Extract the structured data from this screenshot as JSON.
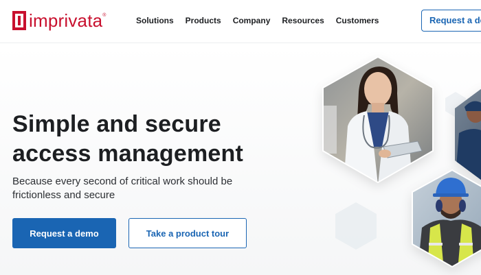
{
  "brand": {
    "name": "imprivata",
    "registered": "®",
    "color": "#c8102e"
  },
  "nav": {
    "items": [
      {
        "label": "Solutions"
      },
      {
        "label": "Products"
      },
      {
        "label": "Company"
      },
      {
        "label": "Resources"
      },
      {
        "label": "Customers"
      }
    ],
    "cta_label": "Request a demo"
  },
  "hero": {
    "title_line1": "Simple and secure",
    "title_line2": "access management",
    "subtitle": "Because every second of critical work should be frictionless and secure",
    "primary_button": "Request a demo",
    "secondary_button": "Take a product tour",
    "images": [
      {
        "icon": "doctor-with-tablet-photo"
      },
      {
        "icon": "clinician-photo"
      },
      {
        "icon": "construction-worker-photo"
      }
    ]
  },
  "colors": {
    "accent": "#1a65b3",
    "text": "#1d1f22"
  }
}
